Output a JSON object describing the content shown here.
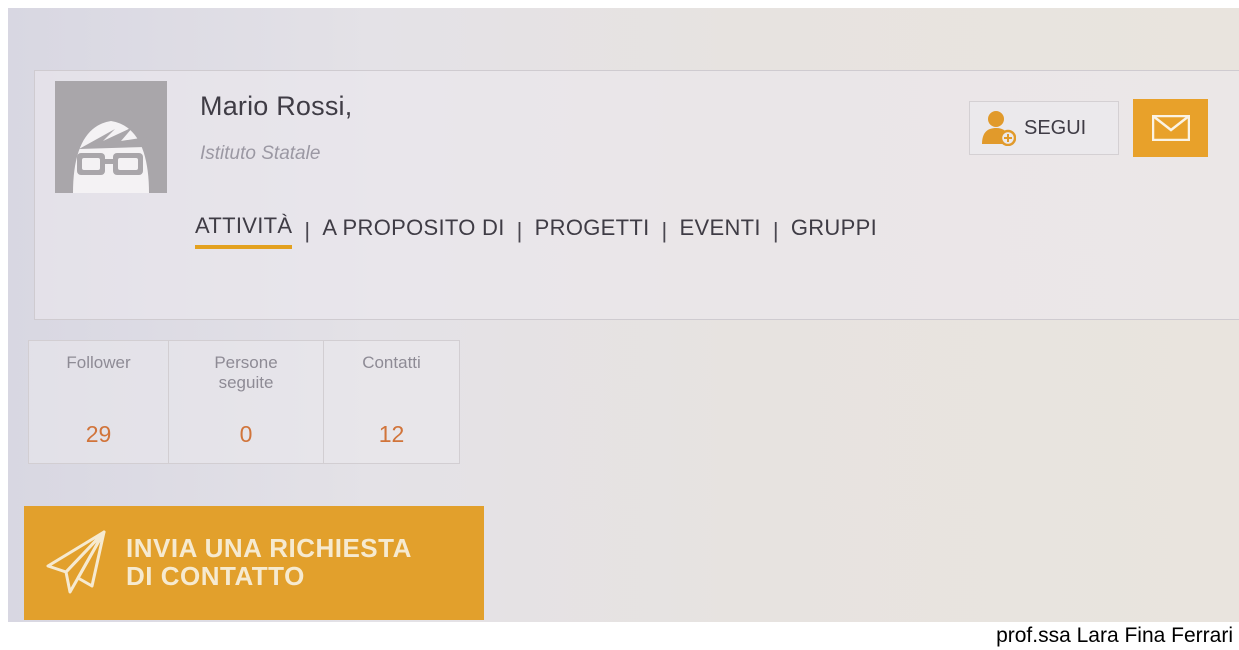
{
  "profile": {
    "name": "Mario Rossi,",
    "organization": "Istituto Statale"
  },
  "nav": {
    "items": [
      {
        "label": "ATTIVITÀ",
        "active": true
      },
      {
        "label": "A PROPOSITO DI",
        "active": false
      },
      {
        "label": "PROGETTI",
        "active": false
      },
      {
        "label": "EVENTI",
        "active": false
      },
      {
        "label": "GRUPPI",
        "active": false
      }
    ],
    "separator": "|"
  },
  "actions": {
    "follow_label": "SEGUI",
    "follow_icon": "user-add-icon",
    "mail_icon": "envelope-icon"
  },
  "stats": [
    {
      "label": "Follower",
      "value": "29"
    },
    {
      "label": "Persone\nseguite",
      "value": "0"
    },
    {
      "label": "Contatti",
      "value": "12"
    }
  ],
  "contact_request": {
    "label": "INVIA UNA RICHIESTA\nDI CONTATTO",
    "icon": "paper-plane-icon"
  },
  "credit": "prof.ssa Lara Fina Ferrari",
  "colors": {
    "accent": "#e3a11f",
    "stat_value": "#d1743a",
    "avatar_bg": "#a9a6aa"
  }
}
